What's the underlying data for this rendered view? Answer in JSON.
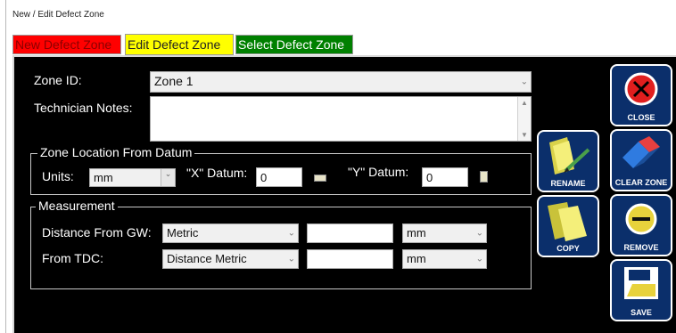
{
  "window": {
    "title": "New / Edit Defect Zone"
  },
  "tabs": [
    {
      "label": "New Defect Zone"
    },
    {
      "label": "Edit Defect Zone"
    },
    {
      "label": "Select Defect Zone"
    }
  ],
  "form": {
    "zone_id_label": "Zone ID:",
    "zone_id_value": "Zone 1",
    "notes_label": "Technician Notes:",
    "notes_value": ""
  },
  "datum": {
    "title": "Zone Location From Datum",
    "units_label": "Units:",
    "units_value": "mm",
    "x_label": "\"X\" Datum:",
    "x_value": "0",
    "y_label": "\"Y\" Datum:",
    "y_value": "0"
  },
  "measurement": {
    "title": "Measurement",
    "gw_label": "Distance From GW:",
    "gw_type": "Metric",
    "gw_value": "",
    "gw_unit": "mm",
    "tdc_label": "From TDC:",
    "tdc_type": "Distance Metric",
    "tdc_value": "",
    "tdc_unit": "mm"
  },
  "buttons": {
    "close": "CLOSE",
    "rename": "RENAME",
    "clear_zone": "CLEAR ZONE",
    "copy": "COPY",
    "remove": "REMOVE",
    "save": "SAVE"
  },
  "colors": {
    "panel_bg": "#000000",
    "button_bg": "#0b2f6b"
  }
}
